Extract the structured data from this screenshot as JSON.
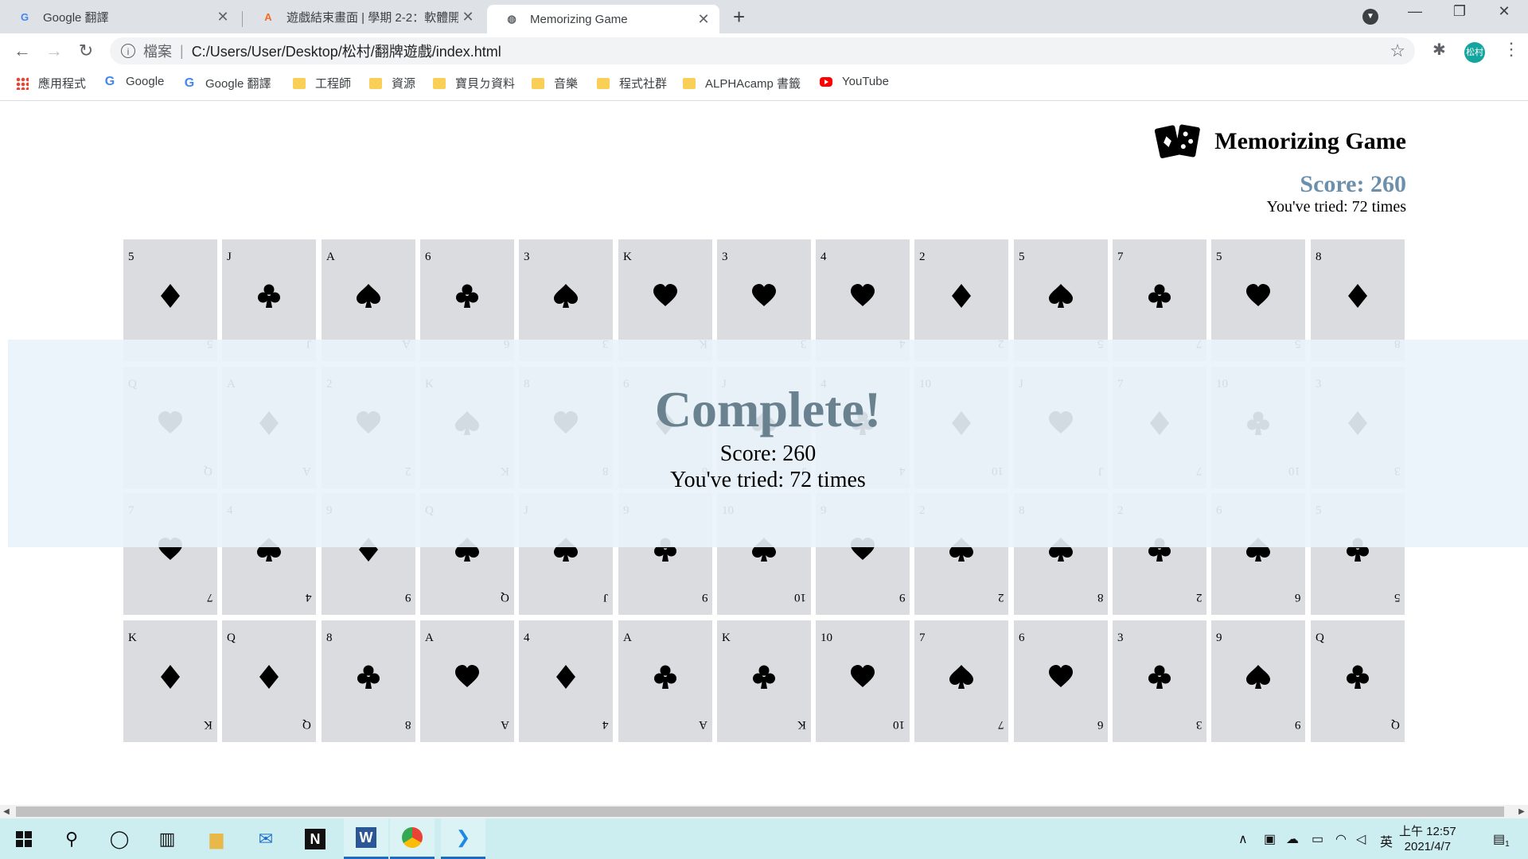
{
  "browser": {
    "tabs": [
      {
        "title": "Google 翻譯",
        "icon": "google-translate-icon",
        "active": false
      },
      {
        "title": "遊戲結束畫面 | 學期 2-2：軟體開",
        "icon": "alphacamp-icon",
        "active": false
      },
      {
        "title": "Memorizing Game",
        "icon": "globe-icon",
        "active": true
      }
    ],
    "address": {
      "security_label": "檔案",
      "url": "C:/Users/User/Desktop/松村/翻牌遊戲/index.html"
    },
    "profile_initials": "松村",
    "bookmarks": [
      {
        "label": "應用程式",
        "icon": "apps-icon"
      },
      {
        "label": "Google",
        "icon": "google-icon"
      },
      {
        "label": "Google 翻譯",
        "icon": "google-translate-icon"
      },
      {
        "label": "工程師",
        "icon": "folder-icon"
      },
      {
        "label": "資源",
        "icon": "folder-icon"
      },
      {
        "label": "寶貝ㄉ資料",
        "icon": "folder-icon"
      },
      {
        "label": "音樂",
        "icon": "folder-icon"
      },
      {
        "label": "程式社群",
        "icon": "folder-icon"
      },
      {
        "label": "ALPHAcamp 書籤",
        "icon": "folder-icon"
      },
      {
        "label": "YouTube",
        "icon": "youtube-icon"
      }
    ]
  },
  "game": {
    "title": "Memorizing Game",
    "score_text": "Score: 260",
    "tried_text": "You've tried: 72 times",
    "cards": [
      [
        [
          "5",
          "diamond"
        ],
        [
          "J",
          "club"
        ],
        [
          "A",
          "spade"
        ],
        [
          "6",
          "club"
        ],
        [
          "3",
          "spade"
        ],
        [
          "K",
          "heart"
        ],
        [
          "3",
          "heart"
        ],
        [
          "4",
          "heart"
        ],
        [
          "2",
          "diamond"
        ],
        [
          "5",
          "spade"
        ],
        [
          "7",
          "club"
        ],
        [
          "5",
          "heart"
        ],
        [
          "8",
          "diamond"
        ]
      ],
      [
        [
          "Q",
          "heart"
        ],
        [
          "A",
          "diamond"
        ],
        [
          "2",
          "heart"
        ],
        [
          "K",
          "spade"
        ],
        [
          "8",
          "heart"
        ],
        [
          "6",
          "diamond"
        ],
        [
          "J",
          "spade"
        ],
        [
          "4",
          "club"
        ],
        [
          "10",
          "diamond"
        ],
        [
          "J",
          "heart"
        ],
        [
          "7",
          "diamond"
        ],
        [
          "10",
          "club"
        ],
        [
          "3",
          "diamond"
        ]
      ],
      [
        [
          "7",
          "heart"
        ],
        [
          "4",
          "spade"
        ],
        [
          "9",
          "diamond"
        ],
        [
          "Q",
          "spade"
        ],
        [
          "J",
          "spade"
        ],
        [
          "9",
          "club"
        ],
        [
          "10",
          "spade"
        ],
        [
          "9",
          "heart"
        ],
        [
          "2",
          "spade"
        ],
        [
          "8",
          "spade"
        ],
        [
          "2",
          "club"
        ],
        [
          "6",
          "spade"
        ],
        [
          "5",
          "club"
        ]
      ],
      [
        [
          "K",
          "diamond"
        ],
        [
          "Q",
          "diamond"
        ],
        [
          "8",
          "club"
        ],
        [
          "A",
          "heart"
        ],
        [
          "4",
          "diamond"
        ],
        [
          "A",
          "club"
        ],
        [
          "K",
          "club"
        ],
        [
          "10",
          "heart"
        ],
        [
          "7",
          "spade"
        ],
        [
          "6",
          "heart"
        ],
        [
          "3",
          "club"
        ],
        [
          "9",
          "spade"
        ],
        [
          "Q",
          "club"
        ]
      ]
    ],
    "complete": {
      "title": "Complete!",
      "score_text": "Score: 260",
      "tried_text": "You've tried: 72 times"
    }
  },
  "taskbar": {
    "apps": [
      "windows-start-icon",
      "search-icon",
      "cortana-icon",
      "task-view-icon",
      "file-explorer-icon",
      "mail-icon",
      "notion-icon",
      "word-icon",
      "chrome-icon",
      "vscode-icon"
    ],
    "ime": "英",
    "clock_time": "上午 12:57",
    "clock_date": "2021/4/7",
    "notification_count": "1"
  }
}
